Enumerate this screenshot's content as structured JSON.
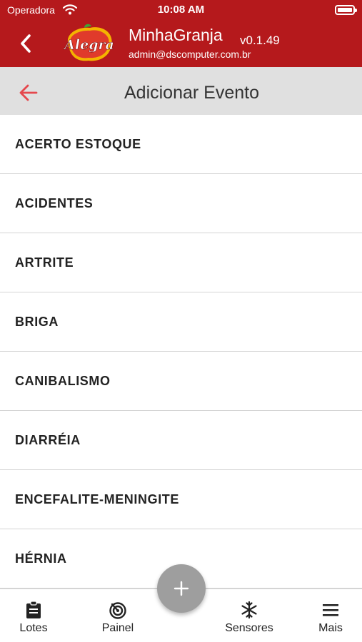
{
  "status_bar": {
    "carrier": "Operadora",
    "time": "10:08 AM",
    "battery_level": 1.0
  },
  "app_header": {
    "logo_text": "Alegra",
    "app_name": "MinhaGranja",
    "version": "v0.1.49",
    "user_email": "admin@dscomputer.com.br",
    "back_icon": "chevron-left-icon"
  },
  "page_header": {
    "title": "Adicionar Evento",
    "back_icon": "arrow-left-icon"
  },
  "events": [
    "ACERTO ESTOQUE",
    "ACIDENTES",
    "ARTRITE",
    "BRIGA",
    "CANIBALISMO",
    "DIARRÉIA",
    "ENCEFALITE-MENINGITE",
    "HÉRNIA"
  ],
  "bottom_nav": {
    "items": [
      {
        "label": "Lotes",
        "icon": "clipboard-icon"
      },
      {
        "label": "Painel",
        "icon": "radar-icon"
      },
      {
        "label": "Sensores",
        "icon": "snowflake-icon"
      },
      {
        "label": "Mais",
        "icon": "menu-icon"
      }
    ],
    "fab_icon": "plus-icon"
  },
  "colors": {
    "brand_red": "#b5191c",
    "accent_red": "#e5484d",
    "header_gray": "#e0e0e0",
    "fab_gray": "#9e9e9e"
  }
}
